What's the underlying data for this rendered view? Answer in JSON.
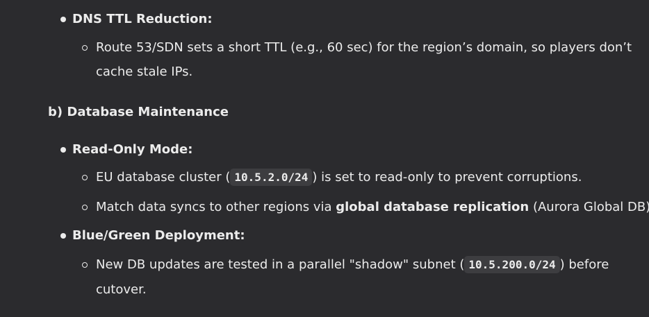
{
  "dns_section": {
    "heading": "DNS TTL Reduction:",
    "item_1_line_1": "Route 53/SDN sets a short TTL (e.g., 60 sec) for the region’s domain, so players don’t",
    "item_1_line_2": "cache stale IPs."
  },
  "db_section": {
    "heading": "b) Database Maintenance",
    "read_only": {
      "heading": "Read-Only Mode:",
      "item_1_before": "EU database cluster (",
      "item_1_code": "10.5.2.0/24",
      "item_1_after": ") is set to read-only to prevent corruptions.",
      "item_2_before": "Match data syncs to other regions via ",
      "item_2_bold": "global database replication",
      "item_2_after": " (Aurora Global DB)."
    },
    "blue_green": {
      "heading": "Blue/Green Deployment:",
      "item_1_before": "New DB updates are tested in a parallel \"shadow\" subnet (",
      "item_1_code": "10.5.200.0/24",
      "item_1_after": ") before",
      "item_1_line_2": "cutover."
    }
  }
}
